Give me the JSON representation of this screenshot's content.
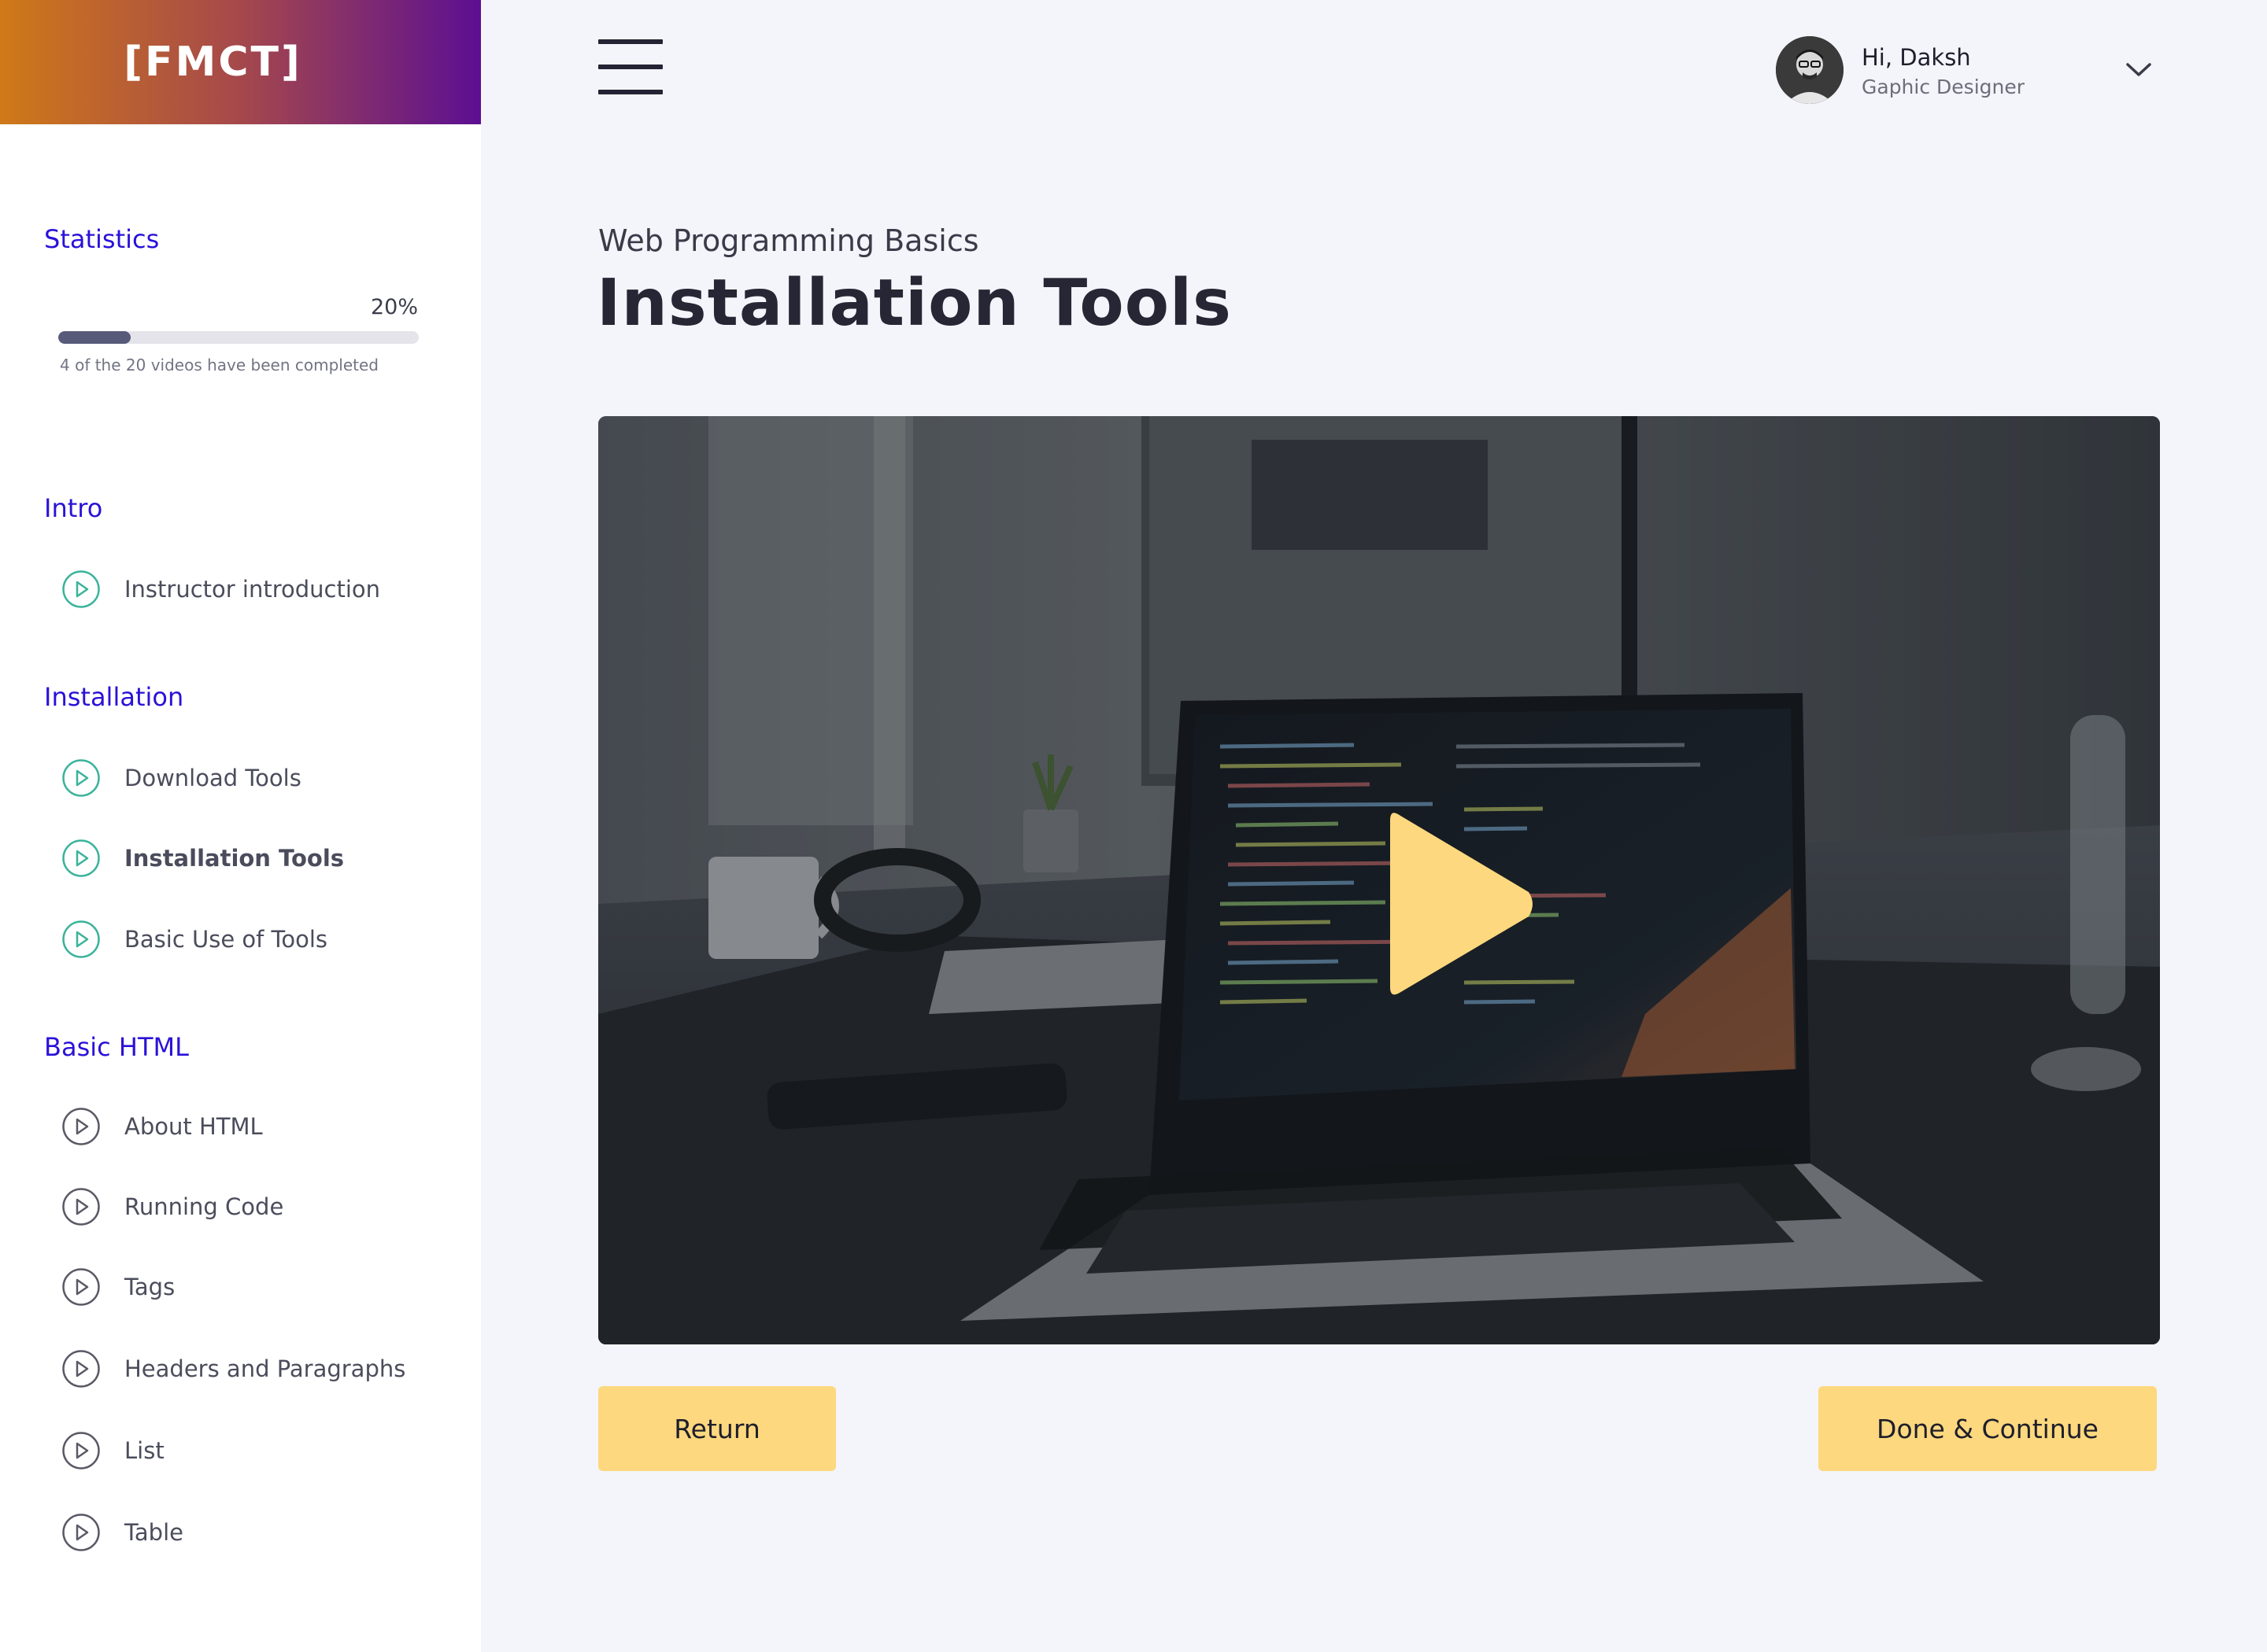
{
  "brand": {
    "name": "[FMCT]"
  },
  "sidebar": {
    "statistics": {
      "heading": "Statistics",
      "percent_label": "20%",
      "progress": 0.2,
      "caption": "4 of the 20 videos have been completed"
    },
    "sections": [
      {
        "heading": "Intro",
        "lessons": [
          {
            "label": "Instructor introduction",
            "status": "completed"
          }
        ]
      },
      {
        "heading": "Installation",
        "lessons": [
          {
            "label": "Download Tools",
            "status": "completed"
          },
          {
            "label": "Installation Tools",
            "status": "current"
          },
          {
            "label": "Basic Use of Tools",
            "status": "completed"
          }
        ]
      },
      {
        "heading": "Basic HTML",
        "lessons": [
          {
            "label": "About HTML",
            "status": "locked"
          },
          {
            "label": "Running Code",
            "status": "locked"
          },
          {
            "label": "Tags",
            "status": "locked"
          },
          {
            "label": "Headers and Paragraphs",
            "status": "locked"
          },
          {
            "label": "List",
            "status": "locked"
          },
          {
            "label": "Table",
            "status": "locked"
          }
        ]
      }
    ]
  },
  "header": {
    "menu_icon": "hamburger-icon",
    "user": {
      "greeting": "Hi, Daksh",
      "role": "Gaphic Designer",
      "dropdown_icon": "chevron-down-icon"
    }
  },
  "main": {
    "course_name": "Web Programming Basics",
    "lesson_title": "Installation Tools",
    "video": {
      "play_icon": "play-icon"
    },
    "buttons": {
      "return_label": "Return",
      "done_label": "Done & Continue"
    }
  },
  "colors": {
    "accent_heading": "#2a12d8",
    "completed_icon": "#3bb39b",
    "locked_icon": "#5a5a66",
    "button": "#fdd87e",
    "play": "#fdd87e",
    "progress_fill": "#585a7a",
    "brand_gradient": [
      "#cf7918",
      "#5c0f92"
    ]
  }
}
